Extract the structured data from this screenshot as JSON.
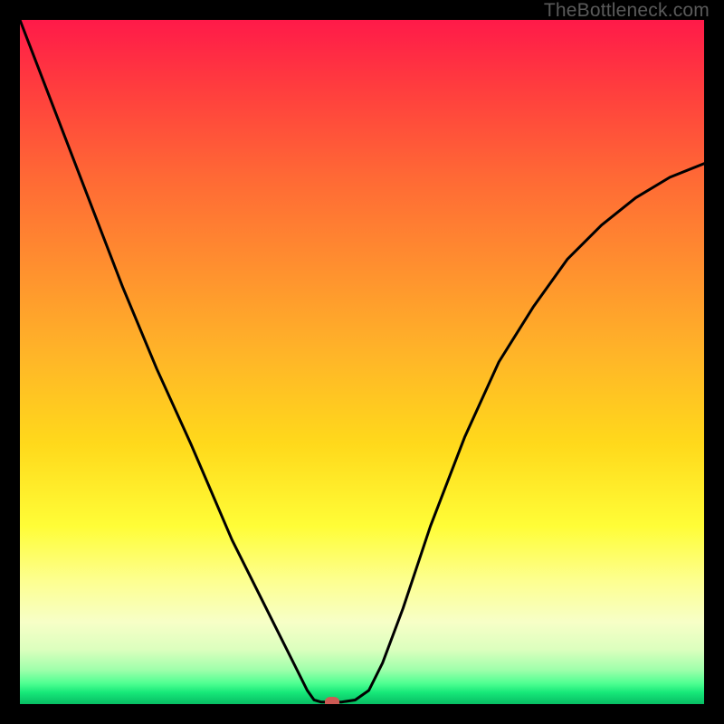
{
  "watermark": "TheBottleneck.com",
  "chart_data": {
    "type": "line",
    "title": "",
    "xlabel": "",
    "ylabel": "",
    "xlim": [
      0,
      1
    ],
    "ylim": [
      0,
      1
    ],
    "grid": false,
    "legend": false,
    "background": "red-yellow-green vertical gradient",
    "series": [
      {
        "name": "curve",
        "color": "#000000",
        "x": [
          0.0,
          0.05,
          0.1,
          0.15,
          0.2,
          0.25,
          0.28,
          0.31,
          0.34,
          0.37,
          0.4,
          0.42,
          0.43,
          0.44,
          0.45,
          0.47,
          0.49,
          0.51,
          0.53,
          0.56,
          0.6,
          0.65,
          0.7,
          0.75,
          0.8,
          0.85,
          0.9,
          0.95,
          1.0
        ],
        "y": [
          1.0,
          0.87,
          0.74,
          0.61,
          0.49,
          0.38,
          0.31,
          0.24,
          0.18,
          0.12,
          0.06,
          0.02,
          0.006,
          0.003,
          0.003,
          0.003,
          0.006,
          0.02,
          0.06,
          0.14,
          0.26,
          0.39,
          0.5,
          0.58,
          0.65,
          0.7,
          0.74,
          0.77,
          0.79
        ]
      }
    ],
    "marker": {
      "x": 0.457,
      "y": 0.003,
      "color": "#cd5a54"
    }
  }
}
